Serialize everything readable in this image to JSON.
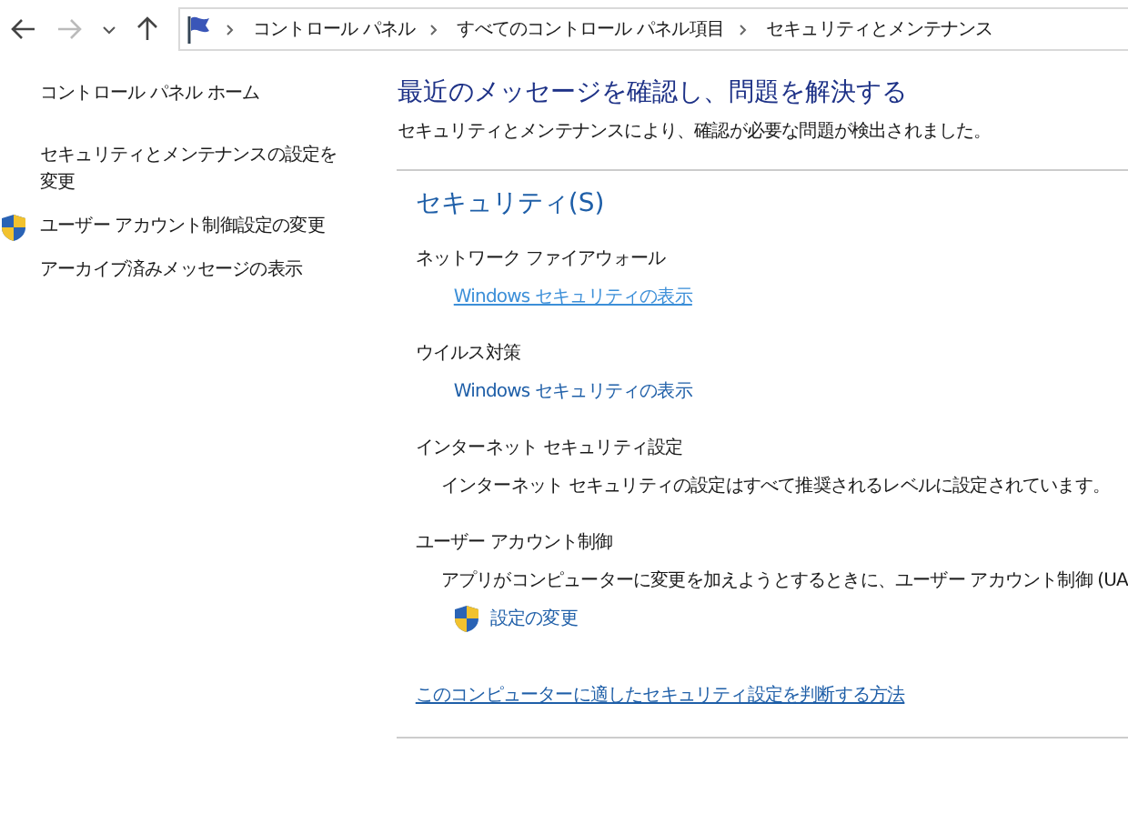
{
  "breadcrumb": [
    "コントロール パネル",
    "すべてのコントロール パネル項目",
    "セキュリティとメンテナンス"
  ],
  "sidebar": {
    "items": [
      {
        "label": "コントロール パネル ホーム",
        "kind": "link"
      },
      {
        "label": "セキュリティとメンテナンスの設定を変更",
        "kind": "link"
      },
      {
        "label": "ユーザー アカウント制御設定の変更",
        "kind": "shield-link"
      },
      {
        "label": "アーカイブ済みメッセージの表示",
        "kind": "link"
      }
    ]
  },
  "main": {
    "title": "最近のメッセージを確認し、問題を解決する",
    "subtitle": "セキュリティとメンテナンスにより、確認が必要な問題が検出されました。",
    "section": {
      "title": "セキュリティ(S)",
      "groups": [
        {
          "title": "ネットワーク ファイアウォール",
          "detail": {
            "kind": "link",
            "text": "Windows セキュリティの表示",
            "hovered": true
          }
        },
        {
          "title": "ウイルス対策",
          "detail": {
            "kind": "link",
            "text": "Windows セキュリティの表示",
            "hovered": false
          }
        },
        {
          "title": "インターネット セキュリティ設定",
          "detail": {
            "kind": "text",
            "text": "インターネット セキュリティの設定はすべて推奨されるレベルに設定されています。"
          }
        },
        {
          "title": "ユーザー アカウント制御",
          "detail": {
            "kind": "text",
            "text": "アプリがコンピューターに変更を加えようとするときに、ユーザー アカウント制御 (UA"
          },
          "action": {
            "kind": "shield-link",
            "text": "設定の変更"
          }
        }
      ],
      "footer_link": "このコンピューターに適したセキュリティ設定を判断する方法"
    }
  }
}
